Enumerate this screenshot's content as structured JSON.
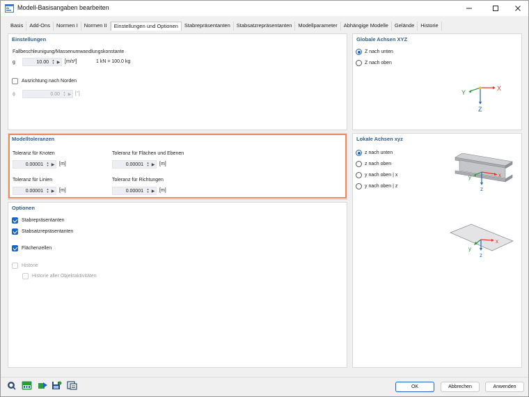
{
  "window": {
    "title": "Modell-Basisangaben bearbeiten"
  },
  "tabs": [
    {
      "label": "Basis"
    },
    {
      "label": "Add-Ons"
    },
    {
      "label": "Normen I"
    },
    {
      "label": "Normen II"
    },
    {
      "label": "Einstellungen und Optionen",
      "active": true
    },
    {
      "label": "Stabrepräsentanten"
    },
    {
      "label": "Stabsatzrepräsentanten"
    },
    {
      "label": "Modellparameter"
    },
    {
      "label": "Abhängige Modelle"
    },
    {
      "label": "Gelände"
    },
    {
      "label": "Historie"
    }
  ],
  "einstellungen": {
    "title": "Einstellungen",
    "gravity_label": "Fallbeschleunigung/Massenumwandlungskonstante",
    "g_symbol": "g",
    "g_value": "10.00",
    "g_unit": "[m/s²]",
    "kn_info": "1 kN = 100.0 kg",
    "north_label": "Ausrichtung nach Norden",
    "north_checked": false,
    "phi_symbol": "ϕ",
    "phi_value": "0.00",
    "phi_unit": "[°]"
  },
  "modelltoleranzen": {
    "title": "Modelltoleranzen",
    "knoten_label": "Toleranz für Knoten",
    "knoten_value": "0.00001",
    "knoten_unit": "[m]",
    "flaechen_label": "Toleranz für Flächen und Ebenen",
    "flaechen_value": "0.00001",
    "flaechen_unit": "[m]",
    "linien_label": "Toleranz für Linien",
    "linien_value": "0.00001",
    "linien_unit": "[m]",
    "richtungen_label": "Toleranz für Richtungen",
    "richtungen_value": "0.00001",
    "richtungen_unit": "[m]"
  },
  "optionen": {
    "title": "Optionen",
    "items": [
      {
        "label": "Stabrepräsentanten",
        "checked": true,
        "enabled": true
      },
      {
        "label": "Stabsatzrepräsentanten",
        "checked": true,
        "enabled": true
      },
      {
        "label": "Flächenzellen",
        "checked": true,
        "enabled": true
      },
      {
        "label": "Historie",
        "checked": false,
        "enabled": false
      },
      {
        "label": "Historie aller Objektaktivitäten",
        "checked": false,
        "enabled": false
      }
    ]
  },
  "globale_achsen": {
    "title": "Globale Achsen XYZ",
    "options": [
      {
        "label": "Z nach unten",
        "selected": true
      },
      {
        "label": "Z nach oben",
        "selected": false
      }
    ],
    "axis_labels": {
      "x": "X",
      "y": "Y",
      "z": "Z"
    }
  },
  "lokale_achsen": {
    "title": "Lokale Achsen xyz",
    "options": [
      {
        "label": "z nach unten",
        "selected": true
      },
      {
        "label": "z nach oben",
        "selected": false
      },
      {
        "label": "y nach oben | x",
        "selected": false
      },
      {
        "label": "y nach oben | z",
        "selected": false
      }
    ],
    "axis_labels": {
      "x": "x",
      "y": "y",
      "z": "z"
    }
  },
  "footer": {
    "ok_label": "OK",
    "cancel_label": "Abbrechen",
    "apply_label": "Anwenden"
  },
  "colors": {
    "accent": "#1f62c8",
    "highlight": "#f08a5d",
    "panel_title": "#2f5d8a",
    "axis_x": "#e2382b",
    "axis_y": "#2e9a3a",
    "axis_z": "#1f62c8"
  }
}
